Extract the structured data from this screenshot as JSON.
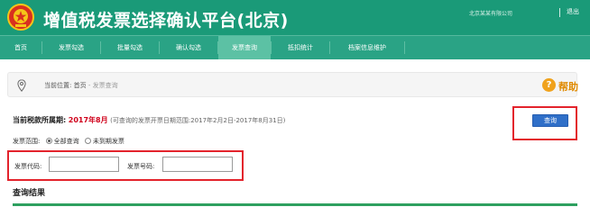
{
  "header": {
    "title": "增值税发票选择确认平台(北京)",
    "user_name": "北京某某有限公司",
    "logout_label": "退出"
  },
  "nav": {
    "items": [
      {
        "label": "首页"
      },
      {
        "label": "发票勾选"
      },
      {
        "label": "批量勾选"
      },
      {
        "label": "确认勾选"
      },
      {
        "label": "发票查询",
        "active": true
      },
      {
        "label": "抵扣统计"
      },
      {
        "label": "档案信息维护"
      }
    ]
  },
  "breadcrumb": {
    "prefix": "当前位置:",
    "home": "首页",
    "separator": " - ",
    "current": "发票查询"
  },
  "help": {
    "icon_glyph": "?",
    "label": "帮助"
  },
  "period": {
    "label": "当前税款所属期:",
    "value": "2017年8月",
    "note": "(可查询的发票开票日期范围:2017年2月2日-2017年8月31日)"
  },
  "query_button": {
    "label": "查询"
  },
  "scope": {
    "label": "发票范围:",
    "options": [
      {
        "label": "全部查询",
        "checked": true
      },
      {
        "label": "未到期发票",
        "checked": false
      }
    ]
  },
  "fields": {
    "invoice_code": {
      "label": "发票代码:",
      "value": ""
    },
    "invoice_number": {
      "label": "发票号码:",
      "value": ""
    }
  },
  "results": {
    "title": "查询结果"
  },
  "colors": {
    "header_green": "#1a9a78",
    "nav_green": "#2aa385",
    "nav_active": "#5cc1a4",
    "highlight_red": "#e3232c",
    "button_blue": "#2f6fc8",
    "period_red": "#d0021b",
    "help_orange": "#f0a21c"
  },
  "icons": {
    "emblem": "national-emblem-icon",
    "location": "location-pin-icon",
    "help": "help-icon"
  }
}
